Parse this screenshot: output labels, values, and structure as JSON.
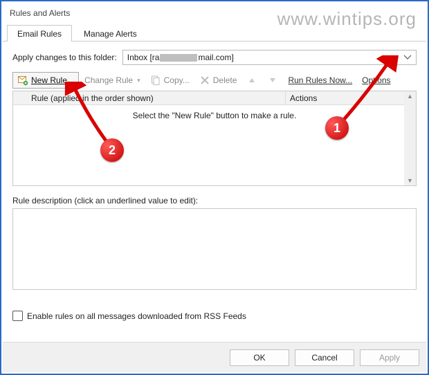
{
  "window": {
    "title": "Rules and Alerts"
  },
  "watermark": "www.wintips.org",
  "tabs": {
    "email": "Email Rules",
    "alerts": "Manage Alerts"
  },
  "folder": {
    "label": "Apply changes to this folder:",
    "value_prefix": "Inbox [ra",
    "value_suffix": "mail.com]"
  },
  "toolbar": {
    "new_rule": "New Rule...",
    "change_rule": "Change Rule",
    "copy": "Copy...",
    "delete": "Delete",
    "run_rules": "Run Rules Now...",
    "options": "Options"
  },
  "list": {
    "col_rule": "Rule (applied in the order shown)",
    "col_actions": "Actions",
    "empty_msg": "Select the \"New Rule\" button to make a rule."
  },
  "desc": {
    "label": "Rule description (click an underlined value to edit):"
  },
  "rss": {
    "label": "Enable rules on all messages downloaded from RSS Feeds"
  },
  "footer": {
    "ok": "OK",
    "cancel": "Cancel",
    "apply": "Apply"
  },
  "callouts": {
    "one": "1",
    "two": "2"
  }
}
